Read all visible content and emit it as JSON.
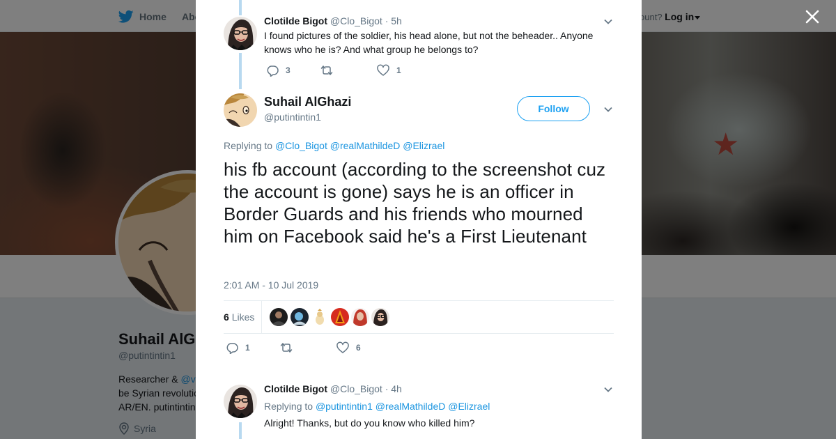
{
  "nav": {
    "home_label": "Home",
    "about_label": "Abo",
    "account_prompt": "ccount?",
    "login_label": "Log in"
  },
  "profile": {
    "name": "Suhail AlGh",
    "handle": "@putintintin1",
    "bio_prefix": "Researcher & ",
    "bio_mention": "@v",
    "bio_line2": "be Syrian revolutio",
    "bio_line3": "AR/EN. putintintin",
    "location": "Syria"
  },
  "modal": {
    "tweet1": {
      "name": "Clotilde Bigot",
      "handle": "@Clo_Bigot",
      "time": "· 5h",
      "text": "I found pictures of the soldier, his head alone, but not the beheader.. Anyone knows who he is? And what group he belongs to?",
      "replies": "3",
      "retweets": "",
      "likes": "1"
    },
    "main": {
      "name": "Suhail AlGhazi",
      "handle": "@putintintin1",
      "follow_label": "Follow",
      "replying_label": "Replying to",
      "mentions": [
        "@Clo_Bigot",
        "@realMathildeD",
        "@Elizrael"
      ],
      "text": "his fb account (according to the screenshot cuz the account is gone) says he is an officer in Border Guards and his friends who mourned him on Facebook said he's a First Lieutenant",
      "timestamp": "2:01 AM - 10 Jul 2019",
      "likes_count": "6",
      "likes_label": "Likes",
      "replies": "1",
      "retweets": "",
      "likes": "6"
    },
    "tweet3": {
      "name": "Clotilde Bigot",
      "handle": "@Clo_Bigot",
      "time": "· 4h",
      "replying_label": "Replying to",
      "mentions": [
        "@putintintin1",
        "@realMathildeD",
        "@Elizrael"
      ],
      "text": "Alright! Thanks, but do you know who killed him?"
    }
  },
  "colors": {
    "accent": "#1da1f2",
    "link": "#1b95e0",
    "muted": "#657786",
    "thread_line": "#b8d9f0"
  },
  "icons": [
    "twitter-bird-icon",
    "close-icon",
    "reply-icon",
    "retweet-icon",
    "heart-icon",
    "chevron-down-icon",
    "location-pin-icon"
  ]
}
